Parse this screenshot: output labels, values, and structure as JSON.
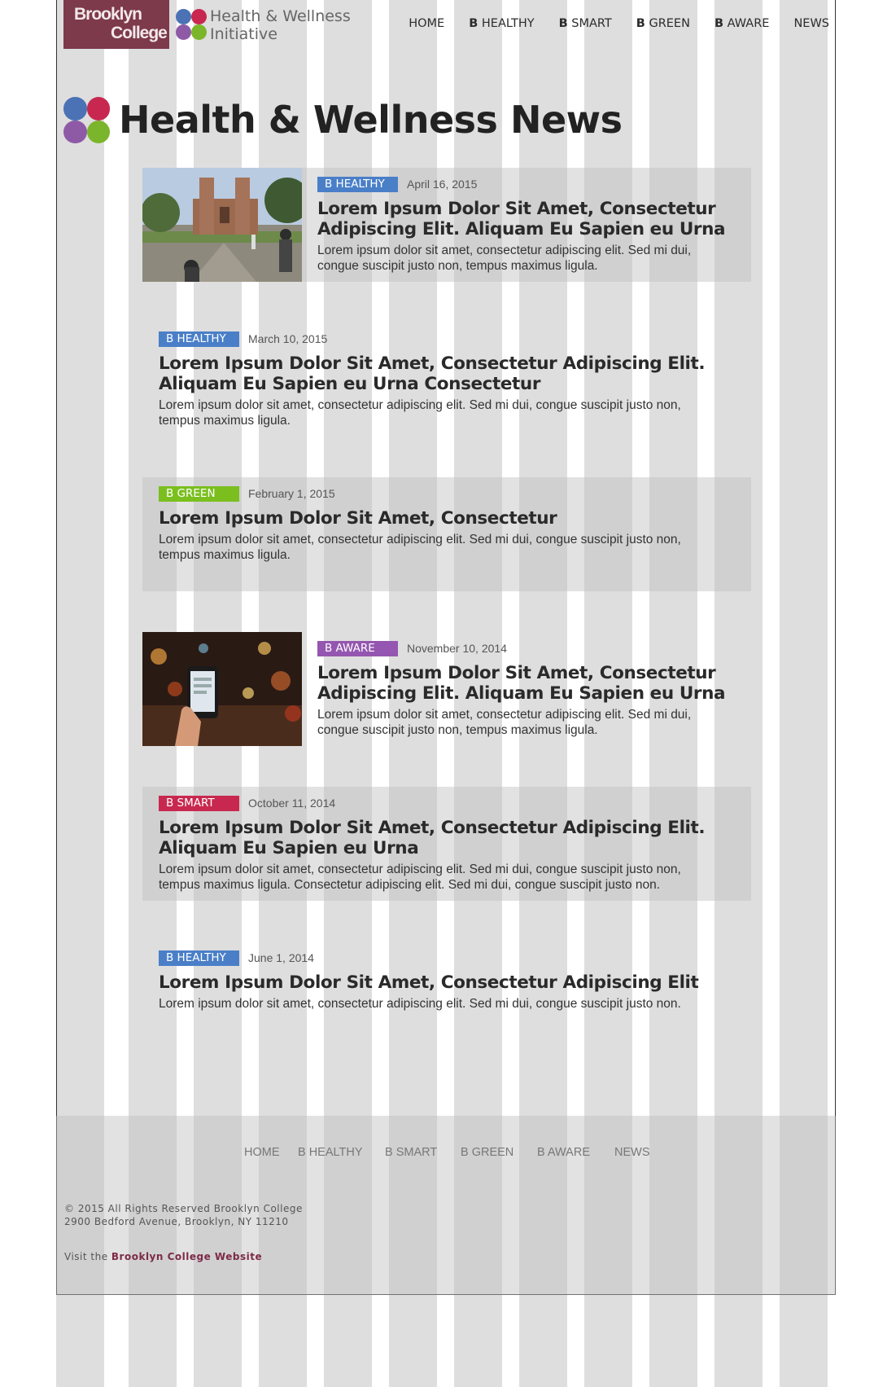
{
  "header": {
    "logo_line1": "Brooklyn",
    "logo_line2": "College",
    "initiative_line1": "Health & Wellness",
    "initiative_line2": "Initiative",
    "nav": [
      {
        "prefix": "",
        "label": "HOME"
      },
      {
        "prefix": "B",
        "label": " HEALTHY"
      },
      {
        "prefix": "B",
        "label": " SMART"
      },
      {
        "prefix": "B",
        "label": " GREEN"
      },
      {
        "prefix": "B",
        "label": " AWARE"
      },
      {
        "prefix": "",
        "label": "NEWS"
      }
    ]
  },
  "page": {
    "title": "Health & Wellness News"
  },
  "colors": {
    "healthy": "#4a7fc8",
    "green": "#7bbf1f",
    "aware": "#9456b0",
    "smart": "#c8284f",
    "brand": "#7d3a4b"
  },
  "articles": [
    {
      "tag": "B HEALTHY",
      "date": "April 16, 2015",
      "headline_l1": "Lorem Ipsum Dolor Sit Amet, Consectetur",
      "headline_l2": "Adipiscing Elit. Aliquam Eu Sapien eu Urna",
      "excerpt_l1": "Lorem ipsum dolor sit amet, consectetur adipiscing elit. Sed mi dui,",
      "excerpt_l2": "congue suscipit justo non, tempus maximus ligula.",
      "image": "campus-photo"
    },
    {
      "tag": "B HEALTHY",
      "date": "March 10, 2015",
      "headline_l1": "Lorem Ipsum Dolor Sit Amet, Consectetur Adipiscing Elit.",
      "headline_l2": "Aliquam Eu Sapien eu Urna Consectetur",
      "excerpt_l1": "Lorem ipsum dolor sit amet, consectetur adipiscing elit. Sed mi dui, congue suscipit justo non,",
      "excerpt_l2": "tempus maximus ligula."
    },
    {
      "tag": "B GREEN",
      "date": "February 1, 2015",
      "headline_l1": "Lorem Ipsum Dolor Sit Amet, Consectetur",
      "headline_l2": "",
      "excerpt_l1": "Lorem ipsum dolor sit amet, consectetur adipiscing elit. Sed mi dui, congue suscipit justo non,",
      "excerpt_l2": "tempus maximus ligula."
    },
    {
      "tag": "B AWARE",
      "date": "November 10, 2014",
      "headline_l1": "Lorem Ipsum Dolor Sit Amet, Consectetur",
      "headline_l2": "Adipiscing Elit. Aliquam Eu Sapien eu Urna",
      "excerpt_l1": "Lorem ipsum dolor sit amet, consectetur adipiscing elit. Sed mi dui,",
      "excerpt_l2": "congue suscipit justo non, tempus maximus ligula.",
      "image": "phone-street-photo"
    },
    {
      "tag": "B SMART",
      "date": "October 11, 2014",
      "headline_l1": "Lorem Ipsum Dolor Sit Amet, Consectetur Adipiscing Elit.",
      "headline_l2": "Aliquam Eu Sapien eu Urna",
      "excerpt_l1": "Lorem ipsum dolor sit amet, consectetur adipiscing elit. Sed mi dui, congue suscipit justo non,",
      "excerpt_l2": "tempus maximus ligula. Consectetur adipiscing elit. Sed mi dui, congue suscipit justo non."
    },
    {
      "tag": "B HEALTHY",
      "date": "June 1, 2014",
      "headline_l1": "Lorem Ipsum Dolor Sit Amet, Consectetur Adipiscing Elit",
      "headline_l2": "",
      "excerpt_l1": "Lorem ipsum dolor sit amet, consectetur adipiscing elit. Sed mi dui, congue suscipit justo non.",
      "excerpt_l2": ""
    }
  ],
  "footer": {
    "nav": [
      "HOME",
      "B HEALTHY",
      "B SMART",
      "B GREEN",
      "B AWARE",
      "NEWS"
    ],
    "copyright": "© 2015 All Rights Reserved Brooklyn College",
    "address": "2900 Bedford Avenue, Brooklyn, NY 11210",
    "visit_prefix": "Visit the ",
    "visit_link": "Brooklyn College Website"
  }
}
